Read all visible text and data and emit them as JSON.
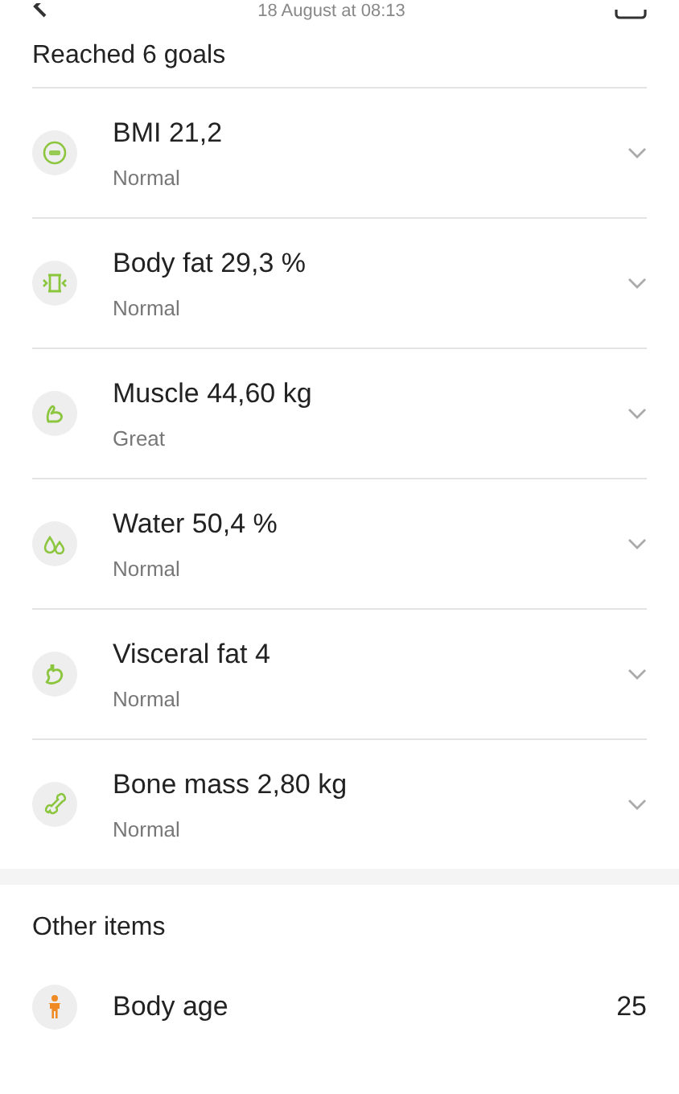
{
  "header": {
    "date": "18 August at 08:13"
  },
  "goals": {
    "title": "Reached 6 goals",
    "items": [
      {
        "label": "BMI 21,2",
        "status": "Normal"
      },
      {
        "label": "Body fat 29,3 %",
        "status": "Normal"
      },
      {
        "label": "Muscle 44,60 kg",
        "status": "Great"
      },
      {
        "label": "Water 50,4 %",
        "status": "Normal"
      },
      {
        "label": "Visceral fat 4",
        "status": "Normal"
      },
      {
        "label": "Bone mass 2,80 kg",
        "status": "Normal"
      }
    ]
  },
  "other": {
    "title": "Other items",
    "items": [
      {
        "label": "Body age",
        "value": "25"
      }
    ]
  }
}
